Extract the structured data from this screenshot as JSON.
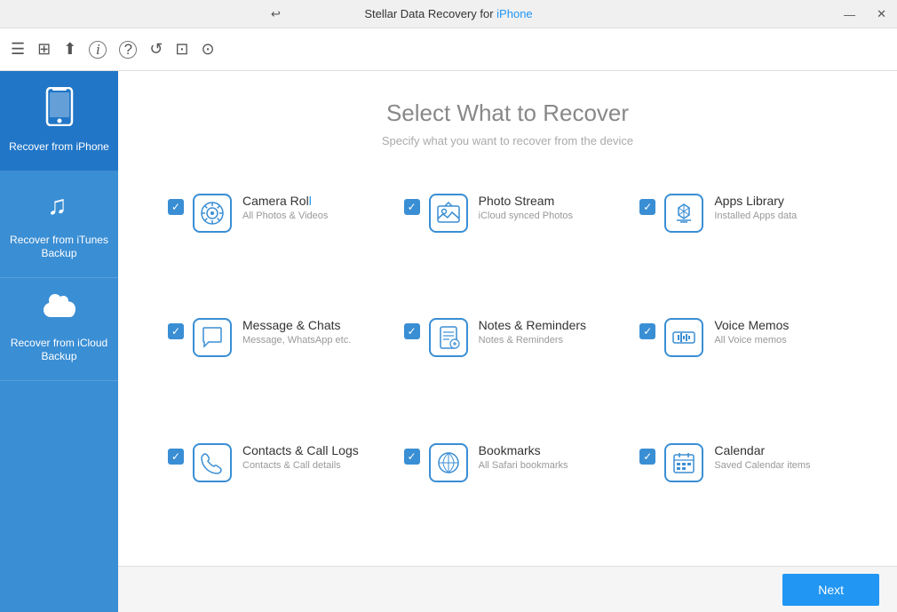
{
  "titleBar": {
    "prefix": "  Stellar Data Recovery for ",
    "highlight": "iPhone",
    "backIcon": "↩",
    "minBtn": "—",
    "closeBtn": "✕"
  },
  "toolbar": {
    "icons": [
      {
        "name": "menu-icon",
        "symbol": "☰"
      },
      {
        "name": "bookmark-icon",
        "symbol": "📋"
      },
      {
        "name": "share-icon",
        "symbol": "⬆"
      },
      {
        "name": "info-icon",
        "symbol": "ℹ"
      },
      {
        "name": "help-icon",
        "symbol": "?"
      },
      {
        "name": "refresh-icon",
        "symbol": "↺"
      },
      {
        "name": "cart-icon",
        "symbol": "🛒"
      },
      {
        "name": "account-icon",
        "symbol": "👤"
      }
    ]
  },
  "sidebar": {
    "items": [
      {
        "id": "recover-iphone",
        "label": "Recover from iPhone",
        "icon": "📱",
        "active": true
      },
      {
        "id": "recover-itunes",
        "label": "Recover from iTunes Backup",
        "icon": "♫",
        "active": false
      },
      {
        "id": "recover-icloud",
        "label": "Recover from iCloud Backup",
        "icon": "☁",
        "active": false
      }
    ]
  },
  "content": {
    "title": "Select What to Recover",
    "subtitle": "Specify what you want to recover from the device",
    "options": [
      {
        "id": "camera-roll",
        "checked": true,
        "title": "Camera Rol",
        "titleHighlight": "l",
        "subtitle": "All Photos & Videos",
        "icon": "🌸"
      },
      {
        "id": "photo-stream",
        "checked": true,
        "title": "Photo Stream",
        "titleHighlight": "",
        "subtitle": "iCloud synced Photos",
        "icon": "📷"
      },
      {
        "id": "apps-library",
        "checked": true,
        "title": "Apps Library",
        "titleHighlight": "",
        "subtitle": "Installed Apps data",
        "icon": "✈"
      },
      {
        "id": "message-chats",
        "checked": true,
        "title": "Message & Chats",
        "titleHighlight": "",
        "subtitle": "Message, WhatsApp etc.",
        "icon": "💬"
      },
      {
        "id": "notes-reminders",
        "checked": true,
        "title": "Notes & Reminders",
        "titleHighlight": "",
        "subtitle": "Notes & Reminders",
        "icon": "📝"
      },
      {
        "id": "voice-memos",
        "checked": true,
        "title": "Voice Memos",
        "titleHighlight": "",
        "subtitle": "All Voice memos",
        "icon": "🔊"
      },
      {
        "id": "contacts-call-logs",
        "checked": true,
        "title": "Contacts & Call Logs",
        "titleHighlight": "",
        "subtitle": "Contacts & Call details",
        "icon": "📞"
      },
      {
        "id": "bookmarks",
        "checked": true,
        "title": "Bookmarks",
        "titleHighlight": "",
        "subtitle": "All Safari bookmarks",
        "icon": "🧭"
      },
      {
        "id": "calendar",
        "checked": true,
        "title": "Calendar",
        "titleHighlight": "",
        "subtitle": "Saved Calendar items",
        "icon": "📅"
      }
    ]
  },
  "footer": {
    "nextLabel": "Next"
  }
}
